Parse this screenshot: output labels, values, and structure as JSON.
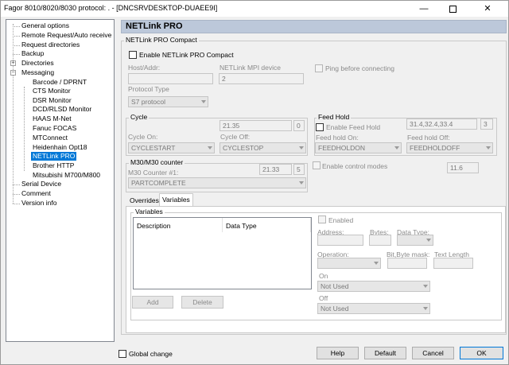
{
  "window": {
    "title": "Fagor 8010/8020/8030 protocol: . - [DNCSRVDESKTOP-DUAEE9I]",
    "controls": {
      "minimize": "—",
      "close": "✕"
    }
  },
  "tree": {
    "items": [
      {
        "label": "General options"
      },
      {
        "label": "Remote Request/Auto receive"
      },
      {
        "label": "Request directories"
      },
      {
        "label": "Backup"
      },
      {
        "label": "Directories"
      },
      {
        "label": "Messaging"
      },
      {
        "label": "Barcode / DPRNT"
      },
      {
        "label": "CTS Monitor"
      },
      {
        "label": "DSR Monitor"
      },
      {
        "label": "DCD/RLSD Monitor"
      },
      {
        "label": "HAAS M-Net"
      },
      {
        "label": "Fanuc FOCAS"
      },
      {
        "label": "MTConnect"
      },
      {
        "label": "Heidenhain Opt18"
      },
      {
        "label": "NETLink PRO"
      },
      {
        "label": "Brother HTTP"
      },
      {
        "label": "Mitsubishi M700/M800"
      },
      {
        "label": "Serial Device"
      },
      {
        "label": "Comment"
      },
      {
        "label": "Version info"
      }
    ],
    "expanders": {
      "directories": "+",
      "messaging": "−"
    }
  },
  "panel": {
    "title": "NETLink PRO",
    "group_title": "NETLink PRO Compact",
    "enable_label": "Enable NETLink PRO Compact",
    "host_label": "Host/Addr:",
    "mpi_label": "NETLink MPI device",
    "mpi_value": "2",
    "ping_label": "Ping before connecting",
    "protocol_label": "Protocol Type",
    "protocol_value": "S7 protocol"
  },
  "cycle": {
    "title": "Cycle",
    "value1": "21.35",
    "value2": "0",
    "on_label": "Cycle On:",
    "on_value": "CYCLESTART",
    "off_label": "Cycle Off:",
    "off_value": "CYCLESTOP"
  },
  "feedhold": {
    "title": "Feed Hold",
    "enable_label": "Enable Feed Hold",
    "value1": "31.4,32.4,33.4",
    "value2": "3",
    "on_label": "Feed hold On:",
    "on_value": "FEEDHOLDON",
    "off_label": "Feed hold Off:",
    "off_value": "FEEDHOLDOFF"
  },
  "m30": {
    "title": "M30/M30 counter",
    "counter_label": "M30 Counter #1:",
    "value1": "21.33",
    "value2": "5",
    "combo_value": "PARTCOMPLETE"
  },
  "control_modes": {
    "label": "Enable control modes",
    "value": "11.6"
  },
  "tabs": {
    "overrides": "Overrides",
    "variables": "Variables"
  },
  "variables": {
    "group_title": "Variables",
    "col_description": "Description",
    "col_datatype": "Data Type",
    "add": "Add",
    "delete": "Delete",
    "enabled_label": "Enabled",
    "address_label": "Address:",
    "bytes_label": "Bytes:",
    "datatype_label": "Data Type:",
    "operation_label": "Operation:",
    "bitmask_label": "Bit,Byte mask:",
    "textlength_label": "Text Length",
    "on_label": "On",
    "on_value": "Not Used",
    "off_label": "Off",
    "off_value": "Not Used"
  },
  "footer": {
    "global_change": "Global change",
    "help": "Help",
    "default": "Default",
    "cancel": "Cancel",
    "ok": "OK"
  }
}
